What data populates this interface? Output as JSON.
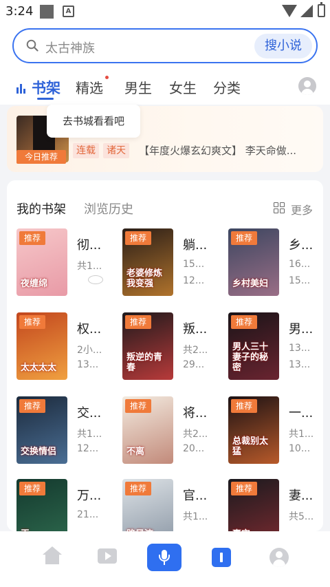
{
  "status_bar": {
    "time": "3:24",
    "notif_letter": "A"
  },
  "search": {
    "placeholder": "太古神族",
    "button": "搜小说"
  },
  "tabs": [
    {
      "label": "书架",
      "active": true
    },
    {
      "label": "精选",
      "active": false,
      "has_dot": true
    },
    {
      "label": "男生",
      "active": false
    },
    {
      "label": "女生",
      "active": false
    },
    {
      "label": "分类",
      "active": false
    }
  ],
  "tooltip": "去书城看看吧",
  "recommend": {
    "badge": "今日推荐",
    "tags": [
      "连载",
      "诸天"
    ],
    "description": "【年度火爆玄幻爽文】 李天命做..."
  },
  "shelf": {
    "tab_shelf": "我的书架",
    "tab_history": "浏览历史",
    "more": "更多",
    "badge": "推荐",
    "books": [
      {
        "title": "彻...",
        "line1": "共1...",
        "line2": "",
        "cover_text": "夜缠绵",
        "cover_colors": [
          "#f6c7c9",
          "#e89aa6"
        ]
      },
      {
        "title": "躺...",
        "line1": "15...",
        "line2": "12...",
        "cover_text": "老婆修炼 我变强",
        "cover_colors": [
          "#2a1e18",
          "#b0732c"
        ]
      },
      {
        "title": "乡...",
        "line1": "16...",
        "line2": "15...",
        "cover_text": "乡村美妇",
        "cover_colors": [
          "#3c4660",
          "#9a6e86"
        ]
      },
      {
        "title": "权...",
        "line1": "2小...",
        "line2": "13...",
        "cover_text": "太太太太",
        "cover_colors": [
          "#c2461e",
          "#f0a040"
        ]
      },
      {
        "title": "叛...",
        "line1": "共2...",
        "line2": "29...",
        "cover_text": "叛逆的青春",
        "cover_colors": [
          "#1e1a1c",
          "#b83a3a"
        ]
      },
      {
        "title": "男...",
        "line1": "13...",
        "line2": "13...",
        "cover_text": "男人三十 妻子的秘密",
        "cover_colors": [
          "#1a1418",
          "#6a2430"
        ]
      },
      {
        "title": "交...",
        "line1": "共1...",
        "line2": "12...",
        "cover_text": "交换情侣",
        "cover_colors": [
          "#1c2a3c",
          "#4a6e94"
        ]
      },
      {
        "title": "将...",
        "line1": "共2...",
        "line2": "20...",
        "cover_text": "不离",
        "cover_colors": [
          "#f3ebe0",
          "#c28a7a"
        ]
      },
      {
        "title": "一...",
        "line1": "共1...",
        "line2": "10...",
        "cover_text": "总裁别太猛",
        "cover_colors": [
          "#1c1214",
          "#b85a2a"
        ]
      },
      {
        "title": "万...",
        "line1": "21...",
        "line2": "",
        "cover_text": "王",
        "cover_colors": [
          "#14392e",
          "#2e6a4e"
        ]
      },
      {
        "title": "官...",
        "line1": "共1...",
        "line2": "",
        "cover_text": "路风流",
        "cover_colors": [
          "#dde2e6",
          "#8a96a4"
        ]
      },
      {
        "title": "妻...",
        "line1": "共5...",
        "line2": "",
        "cover_text": "事实",
        "cover_colors": [
          "#1a1a1e",
          "#7a2a30"
        ]
      }
    ]
  },
  "bottom_nav": [
    "home-icon",
    "video-icon",
    "microphone-icon",
    "bookshelf-icon",
    "profile-icon"
  ],
  "colors": {
    "accent": "#2f63d8",
    "badge": "#f07a3a",
    "tag_bg": "#fbe3dc",
    "tag_text": "#e2683c"
  }
}
